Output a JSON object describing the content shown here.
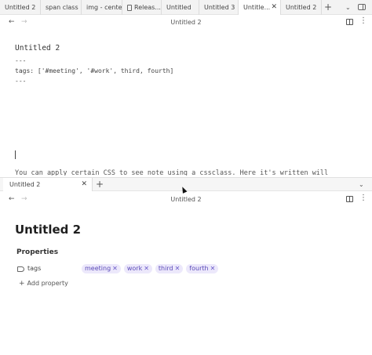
{
  "top_tabs": [
    {
      "label": "Untitled 2",
      "active": false,
      "icon": ""
    },
    {
      "label": "span class",
      "active": false,
      "icon": ""
    },
    {
      "label": "img - center",
      "active": false,
      "icon": ""
    },
    {
      "label": "Releas...",
      "active": false,
      "icon": "doc-icon"
    },
    {
      "label": "Untitled",
      "active": false,
      "icon": ""
    },
    {
      "label": "Untitled 3",
      "active": false,
      "icon": ""
    },
    {
      "label": "Untitle...",
      "active": true,
      "icon": ""
    },
    {
      "label": "Untitled 2",
      "active": false,
      "icon": ""
    }
  ],
  "top_pane": {
    "nav_title": "Untitled 2",
    "heading": "Untitled 2",
    "lines": [
      "---",
      "tags: ['#meeting', '#work', third, fourth]",
      "---"
    ],
    "cut_text": "You can apply certain CSS to see note using a cssclass. Here it's written will"
  },
  "bottom_tab": {
    "label": "Untitled 2"
  },
  "bottom_pane": {
    "nav_title": "Untitled 2",
    "title": "Untitled 2",
    "properties_heading": "Properties",
    "property_key": "tags",
    "tags": [
      "meeting",
      "work",
      "third",
      "fourth"
    ],
    "add_property": "Add property"
  },
  "glyphs": {
    "close": "✕",
    "plus": "+",
    "chevron": "⌄",
    "back": "←",
    "forward": "→",
    "more": "⋮"
  },
  "colors": {
    "chip_bg": "#ece8fb",
    "chip_text": "#5b4bb8"
  }
}
